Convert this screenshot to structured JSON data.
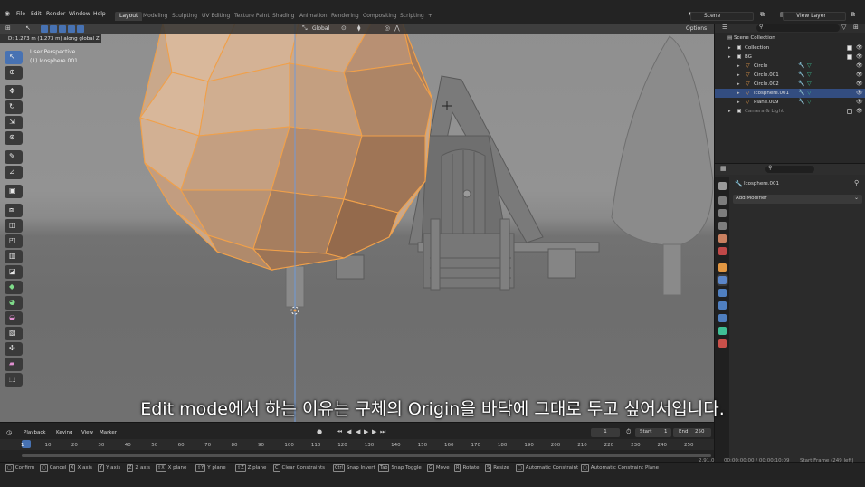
{
  "topbar": {
    "menus": [
      "File",
      "Edit",
      "Render",
      "Window",
      "Help"
    ],
    "workspace_tabs": [
      "Layout",
      "Modeling",
      "Sculpting",
      "UV Editing",
      "Texture Paint",
      "Shading",
      "Animation",
      "Rendering",
      "Compositing",
      "Scripting"
    ],
    "add_tab": "+",
    "scene": "Scene",
    "view_layer": "View Layer"
  },
  "viewport": {
    "transform_info": "D: 1.273 m (1.273 m) along global Z",
    "perspective": "User Perspective",
    "object_name": "(1) Icosphere.001",
    "orientation": "Global",
    "options": "Options"
  },
  "outliner": {
    "title": "Scene Collection",
    "rows": [
      {
        "label": "Collection",
        "indent": 1,
        "selected": false
      },
      {
        "label": "BG",
        "indent": 1,
        "selected": false
      },
      {
        "label": "Circle",
        "indent": 2,
        "selected": false
      },
      {
        "label": "Circle.001",
        "indent": 2,
        "selected": false
      },
      {
        "label": "Circle.002",
        "indent": 2,
        "selected": false
      },
      {
        "label": "Icosphere.001",
        "indent": 2,
        "selected": true
      },
      {
        "label": "Plane.009",
        "indent": 2,
        "selected": false
      },
      {
        "label": "Camera & Light",
        "indent": 1,
        "selected": false
      }
    ]
  },
  "properties": {
    "object_name": "Icosphere.001",
    "add_modifier": "Add Modifier"
  },
  "timeline": {
    "menus": [
      "Playback",
      "Keying",
      "View",
      "Marker"
    ],
    "current_frame": "1",
    "start_label": "Start",
    "start": "1",
    "end_label": "End",
    "end": "250",
    "ticks": [
      "1",
      "10",
      "20",
      "30",
      "40",
      "50",
      "60",
      "70",
      "80",
      "90",
      "100",
      "110",
      "120",
      "130",
      "140",
      "150",
      "160",
      "170",
      "180",
      "190",
      "200",
      "210",
      "220",
      "230",
      "240",
      "250"
    ]
  },
  "statusbar": {
    "items": [
      {
        "key": "",
        "label": "Confirm"
      },
      {
        "key": "",
        "label": "Cancel"
      },
      {
        "key": "X",
        "label": "X axis"
      },
      {
        "key": "Y",
        "label": "Y axis"
      },
      {
        "key": "Z",
        "label": "Z axis"
      },
      {
        "key": "⇧X",
        "label": "X plane"
      },
      {
        "key": "⇧Y",
        "label": "Y plane"
      },
      {
        "key": "⇧Z",
        "label": "Z plane"
      },
      {
        "key": "C",
        "label": "Clear Constraints"
      },
      {
        "key": "Ctrl",
        "label": "Snap Invert"
      },
      {
        "key": "Tab",
        "label": "Snap Toggle"
      },
      {
        "key": "G",
        "label": "Move"
      },
      {
        "key": "R",
        "label": "Rotate"
      },
      {
        "key": "S",
        "label": "Resize"
      },
      {
        "key": "",
        "label": "Automatic Constraint"
      },
      {
        "key": "",
        "label": "Automatic Constraint Plane"
      }
    ],
    "version": "2.91.0",
    "time": "00:00:00:00 / 00:00:10:09",
    "start_frame": "Start Frame (249 left)"
  },
  "subtitle": "Edit mode에서 하는 이유는 구체의 Origin을 바닥에 그대로 두고 싶어서입니다.",
  "colors": {
    "accent": "#4772b3",
    "selection": "#334d80",
    "edit_orange": "#f0a04a",
    "mesh_gray": "#8a8a8a"
  }
}
